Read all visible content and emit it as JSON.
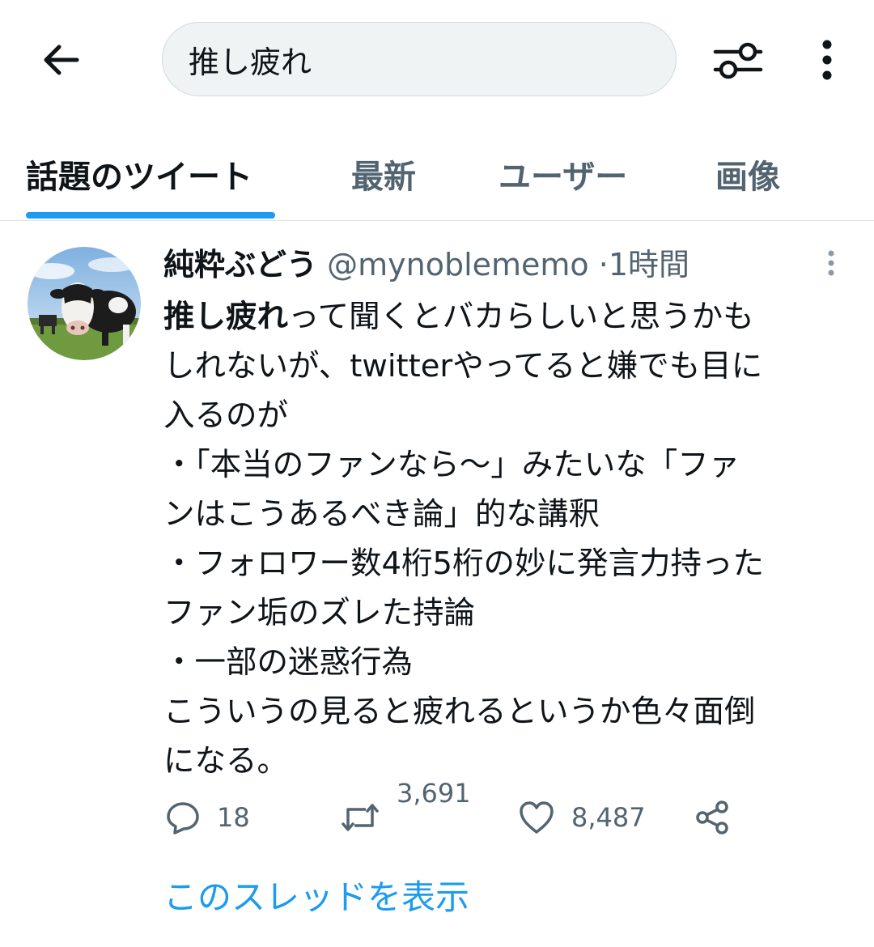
{
  "search": {
    "query": "推し疲れ"
  },
  "tabs": [
    {
      "label": "話題のツイート"
    },
    {
      "label": "最新"
    },
    {
      "label": "ユーザー"
    },
    {
      "label": "画像"
    }
  ],
  "tweet": {
    "display_name": "純粋ぶどう",
    "handle": "@mynoblememo",
    "separator": "·",
    "time": "1時間",
    "body": {
      "highlight": "推し疲れ",
      "line1_rest": "って聞くとバカらしいと思うかも",
      "line2": "しれないが、twitterやってると嫌でも目に",
      "line3": "入るのが",
      "line4": "・「本当のファンなら〜」みたいな「ファ",
      "line5": "ンはこうあるべき論」的な講釈",
      "line6": "・フォロワー数4桁5桁の妙に発言力持った",
      "line7": "ファン垢のズレた持論",
      "line8": "・一部の迷惑行為",
      "line9": "こういうの見ると疲れるというか色々面倒",
      "line10": "になる。"
    },
    "replies": "18",
    "retweets": "3,691",
    "likes": "8,487",
    "thread_link": "このスレッドを表示"
  },
  "colors": {
    "accent": "#1d9bf0",
    "secondary_text": "#536471",
    "search_bg": "#eff3f4"
  },
  "icons": {
    "back": "arrow-left-icon",
    "filter": "sliders-icon",
    "more": "vertical-ellipsis-icon",
    "reply": "speech-bubble-icon",
    "retweet": "retweet-icon",
    "like": "heart-icon",
    "share": "share-icon"
  }
}
